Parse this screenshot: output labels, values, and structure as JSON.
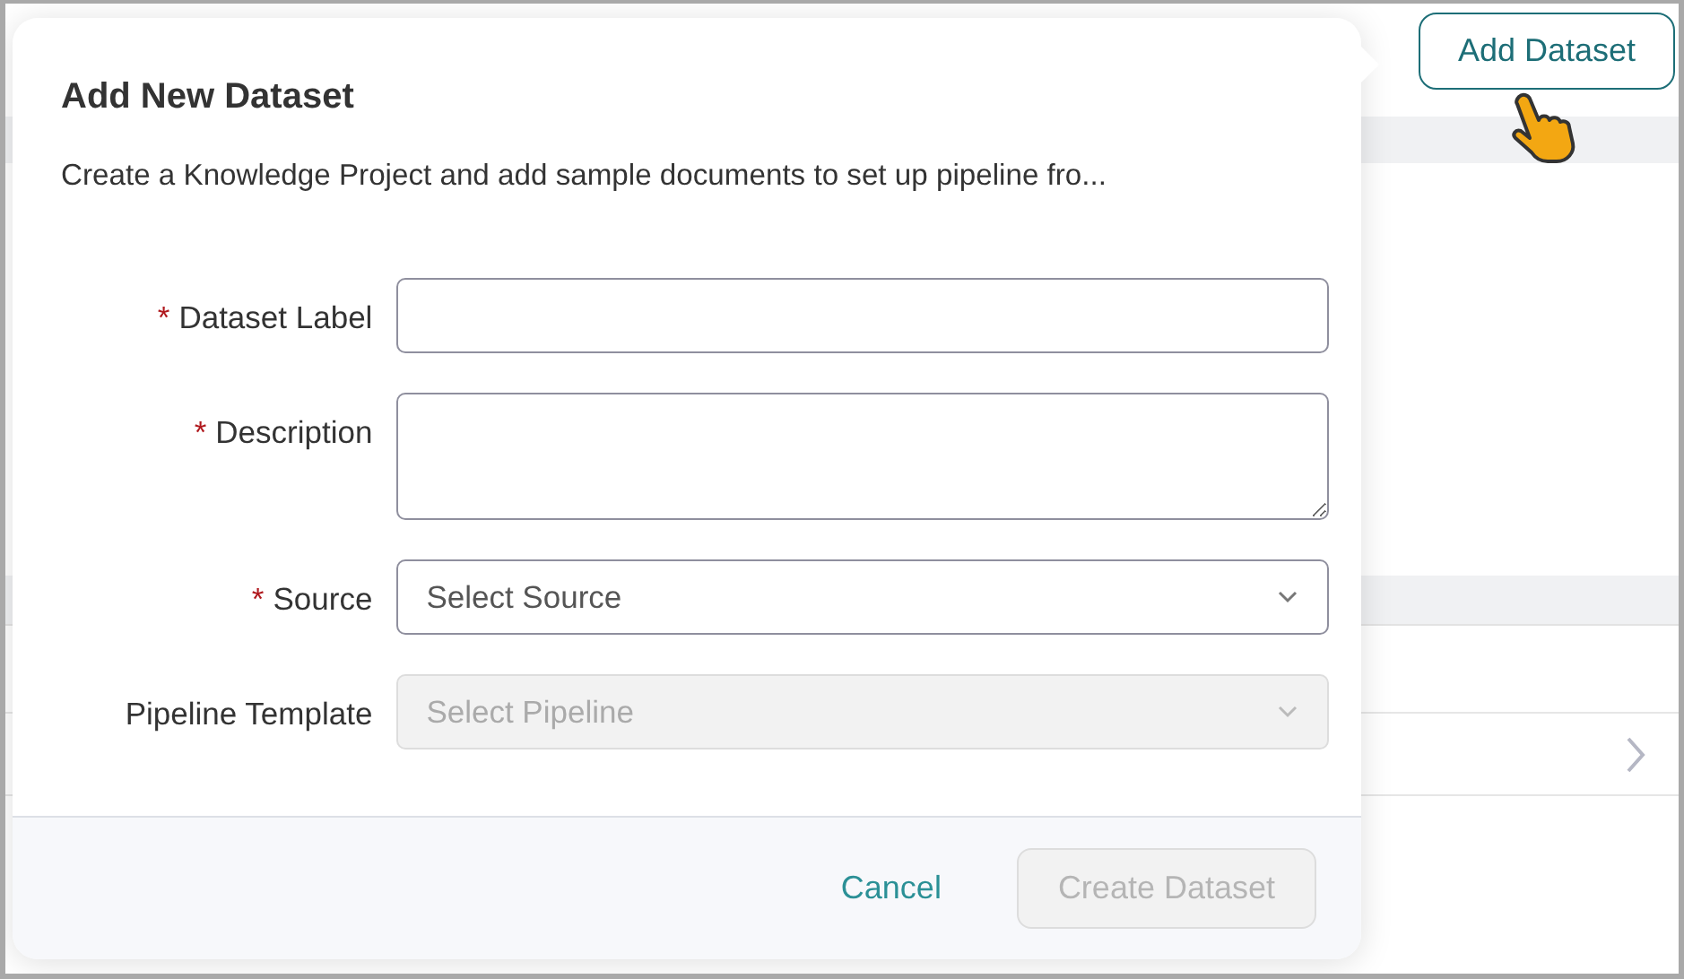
{
  "background": {
    "add_button": "Add Dataset"
  },
  "dialog": {
    "title": "Add New Dataset",
    "subtitle": "Create a Knowledge Project and add sample documents to set up pipeline fro...",
    "required_mark": "*",
    "fields": [
      {
        "label": "Dataset Label",
        "required": true,
        "kind": "text",
        "disabled": false
      },
      {
        "label": "Description",
        "required": true,
        "kind": "textarea",
        "disabled": false
      },
      {
        "label": "Source",
        "required": true,
        "kind": "select",
        "placeholder": "Select Source",
        "disabled": false
      },
      {
        "label": "Pipeline Template",
        "required": false,
        "kind": "select",
        "placeholder": "Select Pipeline",
        "disabled": true
      }
    ],
    "cancel": "Cancel",
    "submit": {
      "label": "Create Dataset",
      "disabled": true
    }
  }
}
